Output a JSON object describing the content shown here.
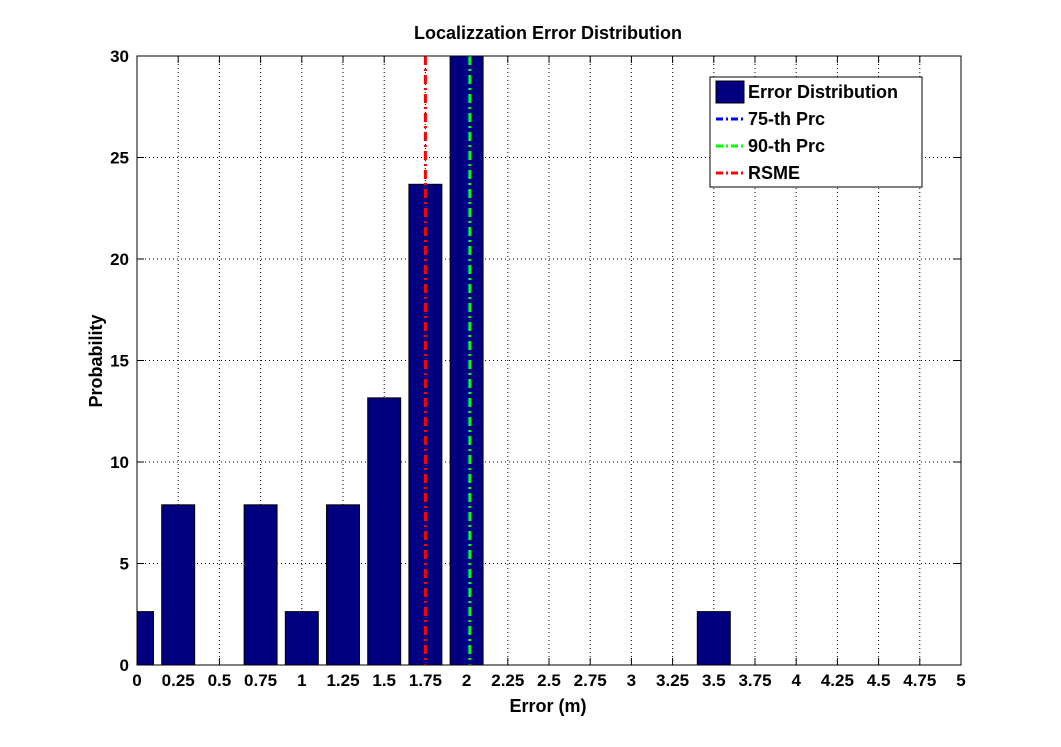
{
  "chart_data": {
    "type": "bar",
    "title": "Localizzation Error Distribution",
    "xlabel": "Error (m)",
    "ylabel": "Probability",
    "xlim": [
      0,
      5
    ],
    "ylim": [
      0,
      30
    ],
    "grid": true,
    "legend_position": "top-right",
    "x_ticks": [
      "0",
      "0.25",
      "0.5",
      "0.75",
      "1",
      "1.25",
      "1.5",
      "1.75",
      "2",
      "2.25",
      "2.5",
      "2.75",
      "3",
      "3.25",
      "3.5",
      "3.75",
      "4",
      "4.25",
      "4.5",
      "4.75",
      "5"
    ],
    "y_ticks": [
      "0",
      "5",
      "10",
      "15",
      "20",
      "25",
      "30"
    ],
    "bar_width": 0.2,
    "series": [
      {
        "name": "Error Distribution",
        "color": "#000080",
        "x": [
          0,
          0.25,
          0.75,
          1.0,
          1.25,
          1.5,
          1.75,
          2.0,
          3.5
        ],
        "values": [
          2.63,
          7.89,
          7.89,
          2.63,
          7.89,
          13.16,
          23.68,
          30.0,
          2.63
        ]
      }
    ],
    "vertical_lines": [
      {
        "name": "75-th Prc",
        "x": 2.01,
        "color": "#0000ff",
        "style": "dashdot"
      },
      {
        "name": "90-th Prc",
        "x": 2.02,
        "color": "#00ff00",
        "style": "dashdot"
      },
      {
        "name": "RSME",
        "x": 1.75,
        "color": "#ff0000",
        "style": "dashdot"
      }
    ]
  }
}
